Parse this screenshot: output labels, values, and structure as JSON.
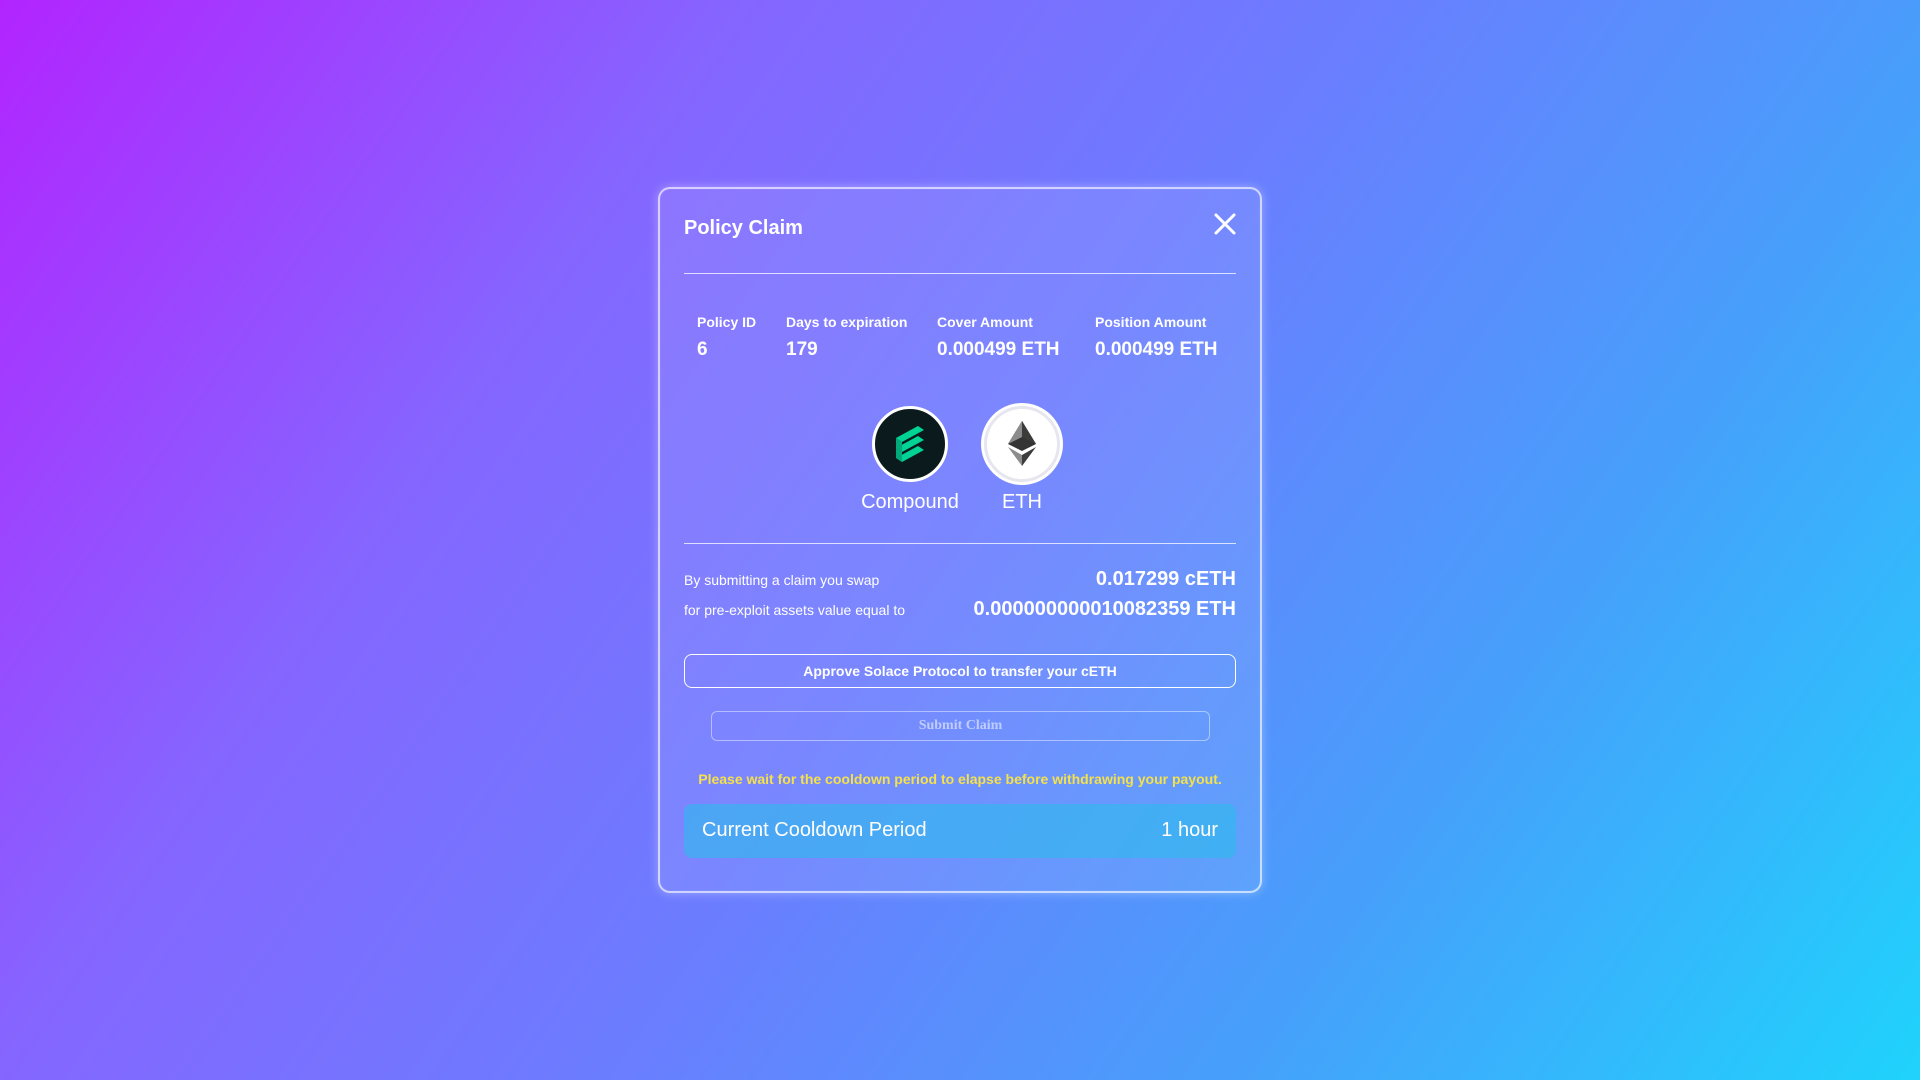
{
  "modal": {
    "title": "Policy Claim",
    "close_icon": "close-icon"
  },
  "policy": {
    "policy_id_label": "Policy ID",
    "policy_id": "6",
    "days_label": "Days to expiration",
    "days": "179",
    "cover_label": "Cover Amount",
    "cover": "0.000499 ETH",
    "position_label": "Position Amount",
    "position": "0.000499 ETH"
  },
  "assets": [
    {
      "name": "Compound",
      "icon": "compound-logo-icon",
      "color": "#00d395"
    },
    {
      "name": "ETH",
      "icon": "ethereum-logo-icon",
      "color": "#343434"
    }
  ],
  "swap": {
    "line1": "By submitting a claim you swap",
    "line2": "for pre-exploit assets value equal to",
    "amount": "0.017299 cETH",
    "value": "0.000000000010082359 ETH"
  },
  "actions": {
    "approve_label": "Approve Solace Protocol to transfer your cETH",
    "submit_label": "Submit Claim"
  },
  "cooldown": {
    "note": "Please wait for the cooldown period to elapse before withdrawing your payout.",
    "label": "Current Cooldown Period",
    "value": "1 hour",
    "note_color": "#f5e14a"
  }
}
